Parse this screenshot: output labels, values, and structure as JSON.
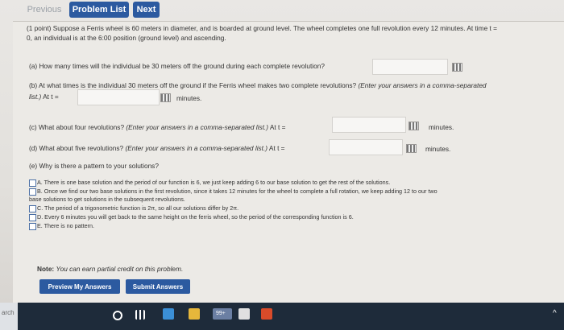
{
  "nav": {
    "previous": "Previous",
    "problem_list": "Problem List",
    "next": "Next"
  },
  "problem": {
    "line1": "(1 point) Suppose a Ferris wheel is 60 meters in diameter, and is boarded at ground level. The wheel completes one full revolution every 12 minutes. At time t =",
    "line2": "0, an individual is at the 6:00 position (ground level) and ascending."
  },
  "part_a": {
    "question": "(a) How many times will the individual be 30 meters off the ground during each complete revolution?"
  },
  "part_b": {
    "question_start": "(b) At what times is the individual 30 meters off the ground if the Ferris wheel makes two complete revolutions?",
    "hint": "(Enter your answers in a comma-separated",
    "line2_hint": "list.)",
    "at_t": "At t =",
    "unit": "minutes."
  },
  "part_c": {
    "question": "(c) What about four revolutions?",
    "hint": "(Enter your answers in a comma-separated list.)",
    "at_t": "At t =",
    "unit": "minutes."
  },
  "part_d": {
    "question": "(d) What about five revolutions?",
    "hint": "(Enter your answers in a comma-separated list.)",
    "at_t": "At t =",
    "unit": "minutes."
  },
  "part_e": {
    "question": "(e) Why is there a pattern to your solutions?",
    "choices": [
      "A. There is one base solution and the period of our function is 6, we just keep adding 6 to our base solution to get the rest of the solutions.",
      "B. Once we find our two base solutions in the first revolution, since it takes 12 minutes for the wheel to complete a full rotation, we keep adding 12 to our two",
      "base solutions to get solutions in the subsequent revolutions.",
      "C. The period of a trigonometric function is 2π, so all our solutions differ by 2π.",
      "D. Every 6 minutes you will get back to the same height on the ferris wheel, so the period of the corresponding function is 6.",
      "E. There is no pattern."
    ]
  },
  "note": {
    "label": "Note:",
    "text": "You can earn partial credit on this problem."
  },
  "buttons": {
    "preview": "Preview My Answers",
    "submit": "Submit Answers"
  },
  "taskbar": {
    "search_text": "arch",
    "badge": "99+"
  }
}
